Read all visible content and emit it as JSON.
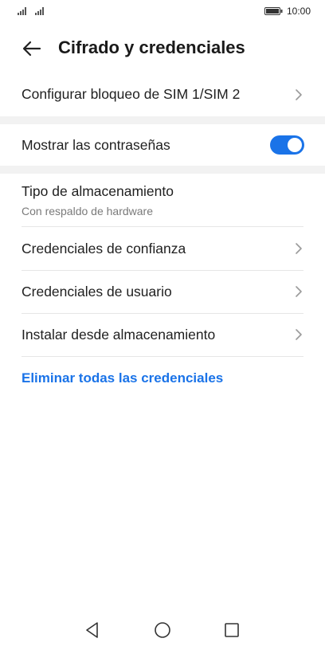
{
  "status_bar": {
    "time": "10:00"
  },
  "header": {
    "title": "Cifrado y credenciales"
  },
  "items": {
    "sim_lock": "Configurar bloqueo de SIM 1/SIM 2",
    "show_passwords": "Mostrar las contraseñas",
    "storage_type": "Tipo de almacenamiento",
    "storage_type_value": "Con respaldo de hardware",
    "trusted_credentials": "Credenciales de confianza",
    "user_credentials": "Credenciales de usuario",
    "install_from_storage": "Instalar desde almacenamiento",
    "clear_credentials": "Eliminar todas las credenciales"
  },
  "toggle": {
    "show_passwords_on": true
  },
  "colors": {
    "accent": "#1a73e8",
    "section_gap": "#f2f2f2"
  },
  "icons": [
    "signal-icon",
    "battery-icon",
    "back-arrow-icon",
    "chevron-right-icon",
    "nav-back-icon",
    "nav-home-icon",
    "nav-recents-icon"
  ]
}
